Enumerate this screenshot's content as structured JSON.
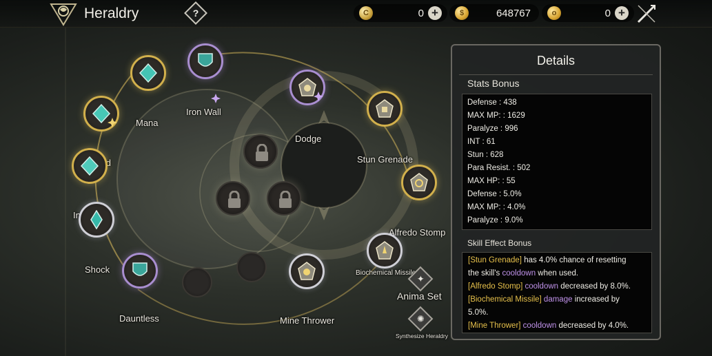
{
  "header": {
    "title": "Heraldry",
    "help_label": "?",
    "currencies": [
      {
        "icon": "crystal-coin-icon",
        "value": "0"
      },
      {
        "icon": "gold-coin-icon",
        "value": "648767"
      },
      {
        "icon": "token-coin-icon",
        "value": "0"
      }
    ]
  },
  "nodes": [
    {
      "label": "Mana"
    },
    {
      "label": "Iron Wall"
    },
    {
      "label": "Bind"
    },
    {
      "label": "Intellect"
    },
    {
      "label": "Shock"
    },
    {
      "label": "Dauntless"
    },
    {
      "label": "Dodge"
    },
    {
      "label": "Stun Grenade"
    },
    {
      "label": "Alfredo Stomp"
    },
    {
      "label": "Biochemical Missile"
    },
    {
      "label": "Mine Thrower"
    }
  ],
  "side_buttons": {
    "anima_set": "Anima Set",
    "synthesize": "Synthesize Heraldry"
  },
  "details": {
    "title": "Details",
    "stats_title": "Stats Bonus",
    "stats": [
      "Defense : 438",
      "MAX MP: : 1629",
      "Paralyze : 996",
      "INT : 61",
      "Stun : 628",
      "Para Resist. : 502",
      "MAX HP: : 55",
      "Defense : 5.0%",
      "MAX MP: : 4.0%",
      "Paralyze : 9.0%"
    ],
    "effects_title": "Skill Effect Bonus",
    "effects": {
      "e1_skill": "[Stun Grenade]",
      "e1_text": " has 4.0% chance of resetting",
      "e1b_text1": "the skill's ",
      "e1b_kw": "cooldown",
      "e1b_text2": " when used.",
      "e2_skill": "[Alfredo Stomp]",
      "e2_kw": " cooldown",
      "e2_text": " decreased by 8.0%.",
      "e3_skill": "[Biochemical Missile]",
      "e3_kw": " damage",
      "e3_text": " increased by",
      "e3b_text": "5.0%.",
      "e4_skill": "[Mine Thrower]",
      "e4_kw": " cooldown",
      "e4_text": " decreased by 4.0%."
    }
  }
}
